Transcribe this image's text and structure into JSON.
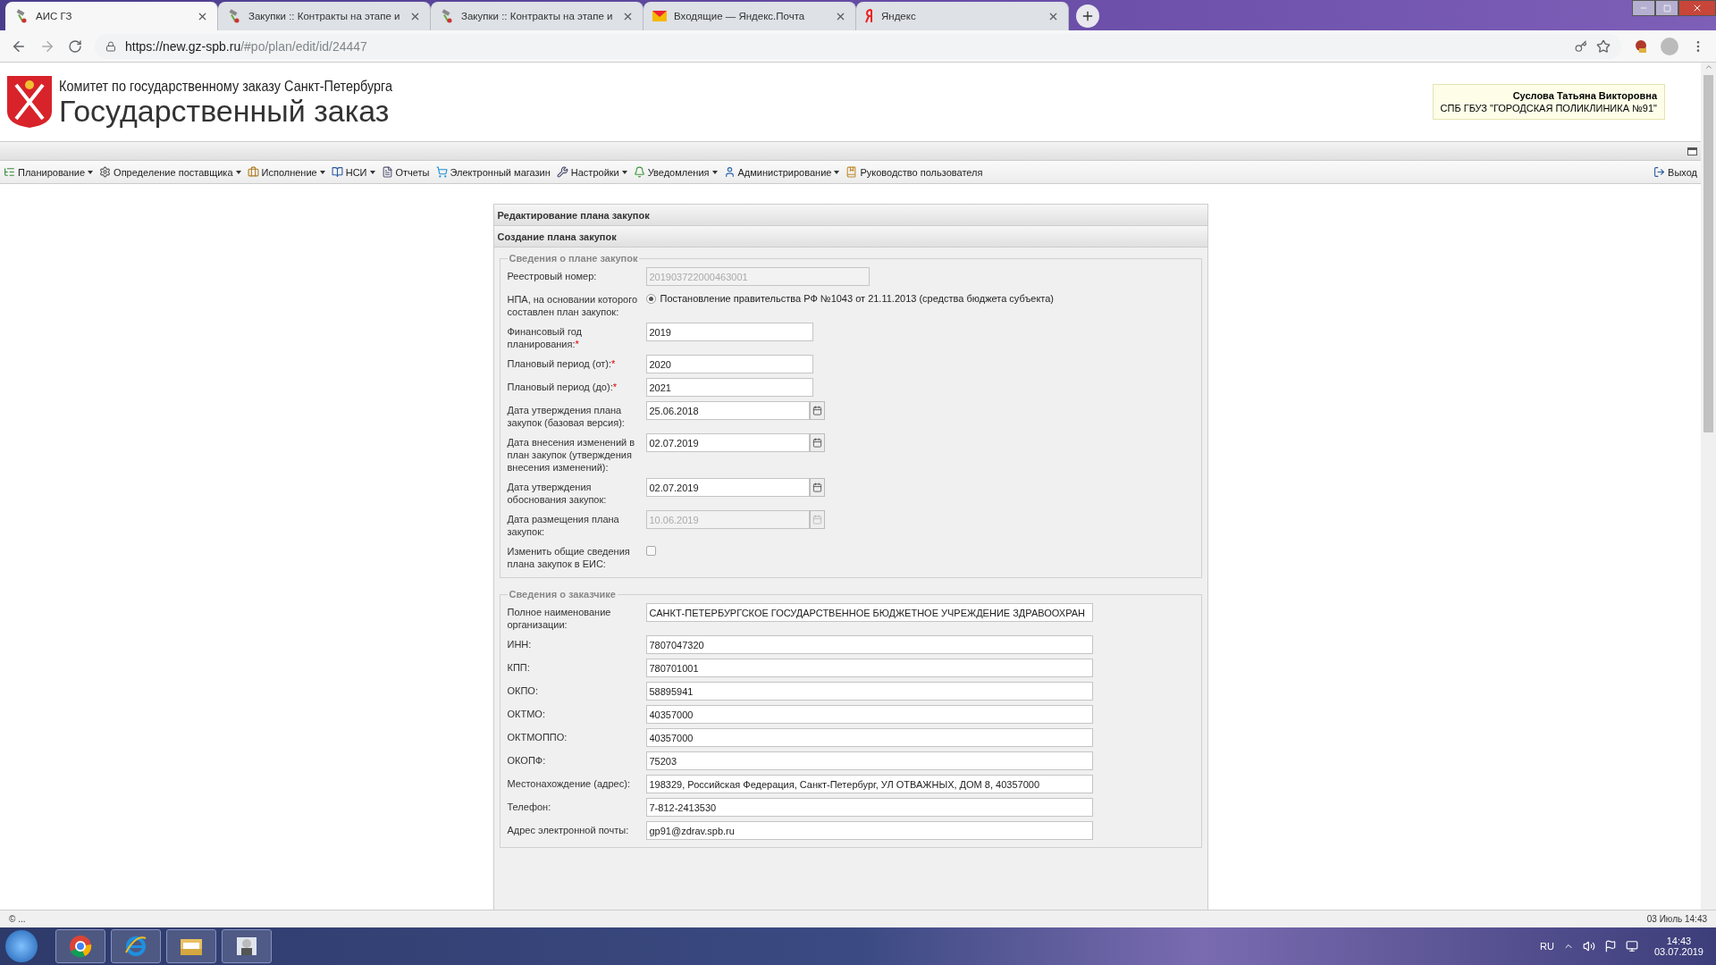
{
  "browser": {
    "tabs": [
      {
        "title": "АИС ГЗ",
        "selected": true,
        "kind": "app"
      },
      {
        "title": "Закупки :: Контракты на этапе и",
        "selected": false,
        "kind": "app"
      },
      {
        "title": "Закупки :: Контракты на этапе и",
        "selected": false,
        "kind": "app"
      },
      {
        "title": "Входящие — Яндекс.Почта",
        "selected": false,
        "kind": "mail"
      },
      {
        "title": "Яндекс",
        "selected": false,
        "kind": "yandex"
      }
    ],
    "url_host": "https://new.gz-spb.ru",
    "url_path": "/#po/plan/edit/id/24447"
  },
  "header": {
    "org_line": "Комитет по государственному заказу Санкт-Петербурга",
    "title": "Государственный заказ",
    "user": {
      "name": "Суслова Татьяна Викторовна",
      "org": "СПБ ГБУЗ \"ГОРОДСКАЯ ПОЛИКЛИНИКА №91\""
    }
  },
  "menu": {
    "items": [
      {
        "label": "Планирование",
        "dropdown": true
      },
      {
        "label": "Определение поставщика",
        "dropdown": true
      },
      {
        "label": "Исполнение",
        "dropdown": true
      },
      {
        "label": "НСИ",
        "dropdown": true
      },
      {
        "label": "Отчеты",
        "dropdown": false
      },
      {
        "label": "Электронный магазин",
        "dropdown": false
      },
      {
        "label": "Настройки",
        "dropdown": true
      },
      {
        "label": "Уведомления",
        "dropdown": true
      },
      {
        "label": "Администрирование",
        "dropdown": true
      },
      {
        "label": "Руководство пользователя",
        "dropdown": false
      }
    ],
    "exit": "Выход"
  },
  "form": {
    "title": "Редактирование плана закупок",
    "subtitle": "Создание плана закупок",
    "sections": [
      {
        "legend": "Сведения о плане закупок",
        "fields": [
          {
            "label": "Реестровый номер:",
            "kind": "text",
            "value": "201903722000463001",
            "disabled": true
          },
          {
            "label": "НПА, на основании которого составлен план закупок:",
            "kind": "radio",
            "value": "Постановление правительства РФ №1043 от 21.11.2013 (средства бюджета субъекта)",
            "checked": true
          },
          {
            "label": "Финансовый год планирования:",
            "required_mark": "*",
            "kind": "text",
            "value": "2019",
            "disabled": false
          },
          {
            "label": "Плановый период (от):",
            "required_mark": "*",
            "kind": "text",
            "value": "2020",
            "disabled": false
          },
          {
            "label": "Плановый период (до):",
            "required_mark": "*",
            "kind": "text",
            "value": "2021",
            "disabled": false
          },
          {
            "label": "Дата утверждения плана закупок (базовая версия):",
            "kind": "date",
            "value": "25.06.2018",
            "disabled": false
          },
          {
            "label": "Дата внесения изменений в план закупок (утверждения внесения изменений):",
            "kind": "date",
            "value": "02.07.2019",
            "disabled": false
          },
          {
            "label": "Дата утверждения обоснования закупок:",
            "kind": "date",
            "value": "02.07.2019",
            "disabled": false
          },
          {
            "label": "Дата размещения плана закупок:",
            "kind": "date",
            "value": "10.06.2019",
            "disabled": true
          },
          {
            "label": "Изменить общие сведения плана закупок в ЕИС:",
            "kind": "checkbox",
            "checked": false
          }
        ]
      },
      {
        "legend": "Сведения о заказчике",
        "fields": [
          {
            "label": "Полное наименование организации:",
            "kind": "text",
            "value": "САНКТ-ПЕТЕРБУРГСКОЕ ГОСУДАРСТВЕННОЕ БЮДЖЕТНОЕ УЧРЕЖДЕНИЕ ЗДРАВООХРАН",
            "disabled": false
          },
          {
            "label": "ИНН:",
            "kind": "text",
            "value": "7807047320",
            "disabled": false
          },
          {
            "label": "КПП:",
            "kind": "text",
            "value": "780701001",
            "disabled": false
          },
          {
            "label": "ОКПО:",
            "kind": "text",
            "value": "58895941",
            "disabled": false
          },
          {
            "label": "ОКТМО:",
            "kind": "text",
            "value": "40357000",
            "disabled": false
          },
          {
            "label": "ОКТМОППО:",
            "kind": "text",
            "value": "40357000",
            "disabled": false
          },
          {
            "label": "ОКОПФ:",
            "kind": "text",
            "value": "75203",
            "disabled": false
          },
          {
            "label": "Местонахождение (адрес):",
            "kind": "text",
            "value": "198329, Российская Федерация, Санкт-Петербург, УЛ ОТВАЖНЫХ, ДОМ 8, 40357000",
            "disabled": false
          },
          {
            "label": "Телефон:",
            "kind": "text",
            "value": "7-812-2413530",
            "disabled": false
          },
          {
            "label": "Адрес электронной почты:",
            "kind": "text",
            "value": "gp91@zdrav.spb.ru",
            "disabled": false
          }
        ]
      }
    ]
  },
  "status_bar": {
    "left": "© ...",
    "right": "03 Июль 14:43"
  },
  "taskbar": {
    "lang": "RU",
    "time": "14:43",
    "date": "03.07.2019"
  }
}
